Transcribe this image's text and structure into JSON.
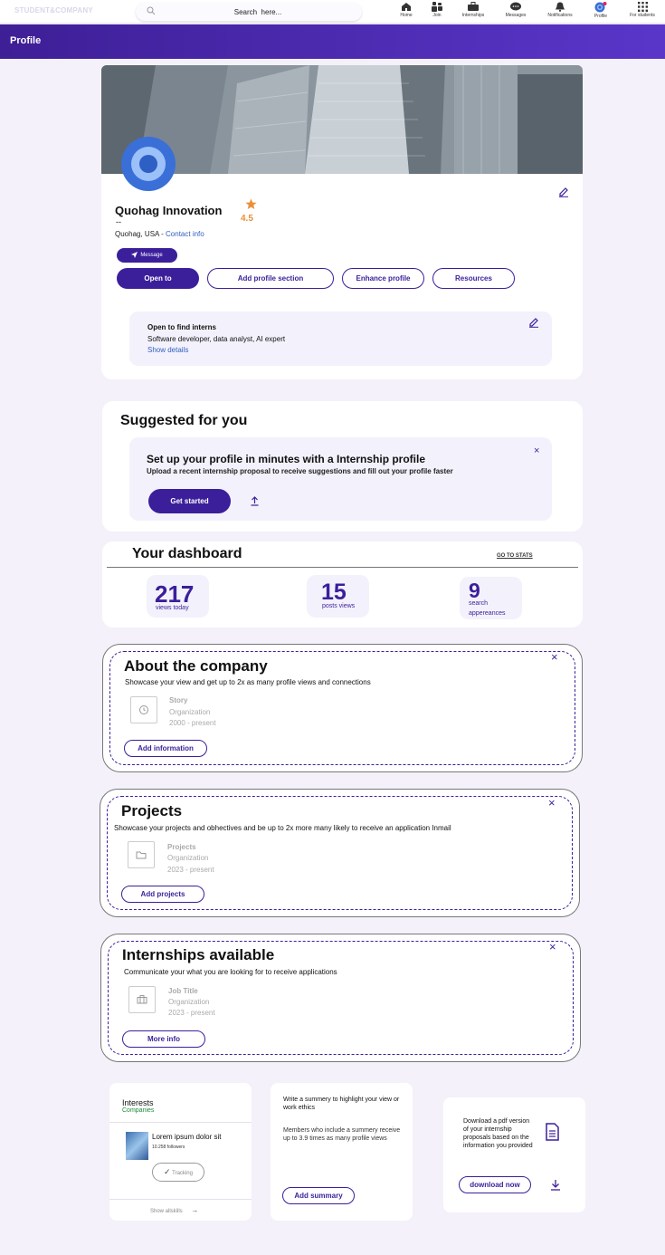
{
  "nav": {
    "brand": "STUDENT&COMPANY",
    "search_placeholder": "Search  here...",
    "items": [
      {
        "label": "Home",
        "icon": "home-icon"
      },
      {
        "label": "Join",
        "icon": "people-icon"
      },
      {
        "label": "Internships",
        "icon": "briefcase-icon"
      },
      {
        "label": "Messages",
        "icon": "chat-icon"
      },
      {
        "label": "Notifications",
        "icon": "bell-icon"
      },
      {
        "label": "Profile",
        "icon": "profile-avatar-icon"
      },
      {
        "label": "For students",
        "icon": "grid-icon"
      }
    ]
  },
  "header": {
    "title": "Profile"
  },
  "profile": {
    "name": "Quohag Innovation",
    "subtitle": "--",
    "rating": "4.5",
    "location": "Quohag, USA - ",
    "contact_link": "Contact info",
    "message_button": "Message",
    "buttons": {
      "open_to": "Open to",
      "add_section": "Add profile section",
      "enhance": "Enhance profile",
      "resources": "Resources"
    },
    "open_to_box": {
      "title": "Open to find interns",
      "roles": "Software developer, data analyst, AI expert",
      "show_details": "Show details"
    }
  },
  "suggested": {
    "title": "Suggested for you",
    "heading": "Set up your profile in minutes with a Internship profile",
    "sub": "Upload a recent internship proposal to receive suggestions and fill out your profile faster",
    "button": "Get started",
    "close": "×"
  },
  "dashboard": {
    "title": "Your dashboard",
    "stats_link": "GO TO STATS",
    "stats": [
      {
        "value": "217",
        "label": "views today"
      },
      {
        "value": "15",
        "label": "posts views"
      },
      {
        "value": "9",
        "label_line1": "search",
        "label_line2": "appereances"
      }
    ]
  },
  "about": {
    "title": "About the company",
    "desc": "Showcase your view and get up to 2x as many profile views and connections",
    "item_title": "Story",
    "item_org": "Organization",
    "item_dates": "2000 - present",
    "button": "Add information",
    "close": "×"
  },
  "projects": {
    "title": "Projects",
    "desc": "Showcase your projects and obhectives and be up to 2x more many likely to receive an application Inmail",
    "item_title": "Projects",
    "item_org": "Organization",
    "item_dates": "2023 - present",
    "button": "Add projects",
    "close": "×"
  },
  "internships": {
    "title": "Internships available",
    "desc": "Communicate your what you are looking for to receive applications",
    "item_title": "Job Title",
    "item_org": "Organization",
    "item_dates": "2023 - present",
    "button": "More info",
    "close": "×"
  },
  "interests": {
    "title": "Interests",
    "tab": "Companies",
    "company_name": "Lorem ipsum dolor sit",
    "followers": "10.258 followers",
    "tracking_button": "Tracking",
    "show_all": "Show allskills"
  },
  "summary": {
    "prompt": "Write a summery to highlight your view or work ethics",
    "info": "Members who include a summery receive up to 3.9 times as many profile views",
    "button": "Add summary"
  },
  "download": {
    "text": "Download a pdf version of your internship proposals based on the information you provided",
    "button": "download now"
  },
  "colors": {
    "accent": "#3b1f9a",
    "rating": "#e8903a",
    "link": "#2f5fbf",
    "companies_tab": "#1a8a3a"
  }
}
